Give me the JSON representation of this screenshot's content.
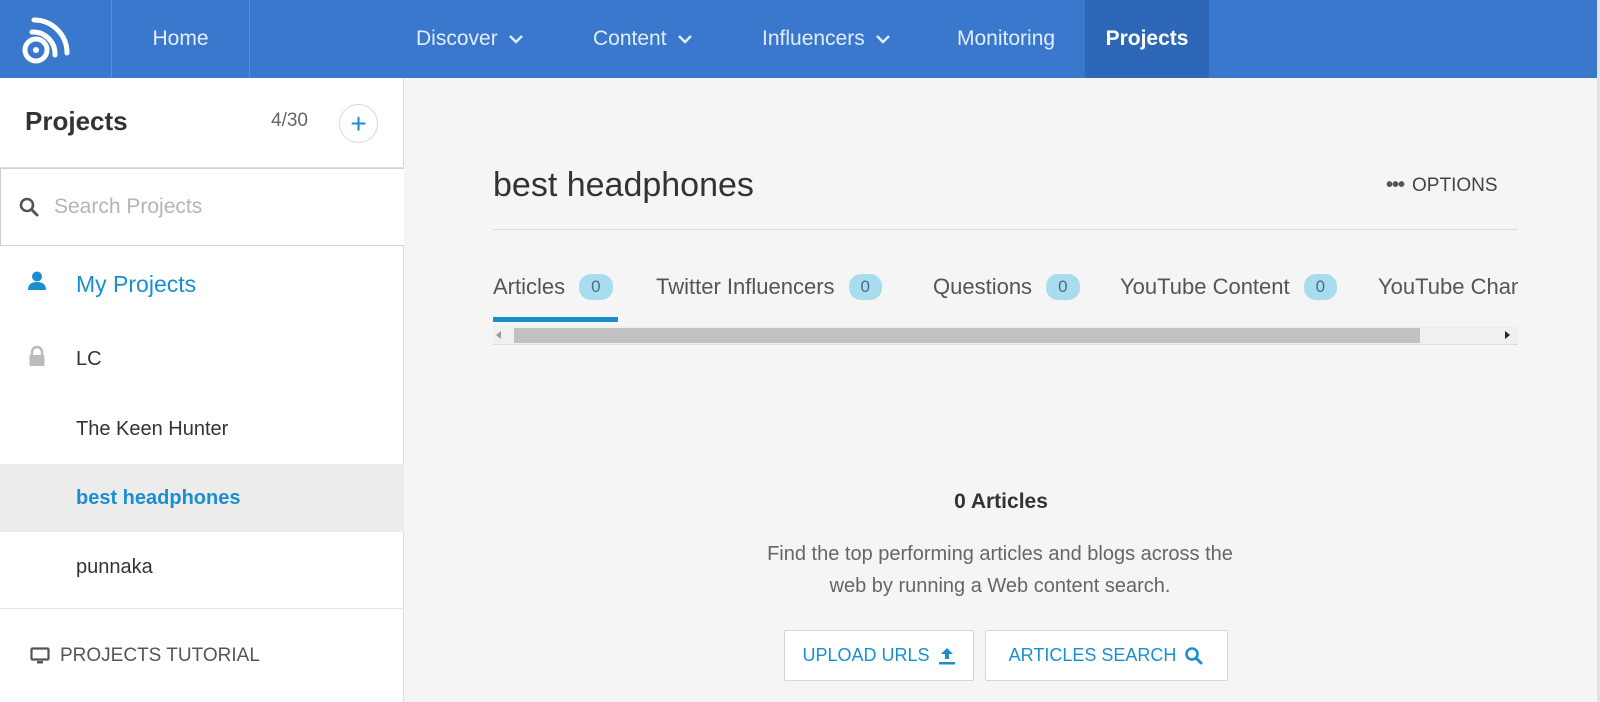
{
  "nav": {
    "home": "Home",
    "items": [
      {
        "label": "Discover",
        "has_dropdown": true
      },
      {
        "label": "Content",
        "has_dropdown": true
      },
      {
        "label": "Influencers",
        "has_dropdown": true
      },
      {
        "label": "Monitoring",
        "has_dropdown": false
      },
      {
        "label": "Projects",
        "has_dropdown": false,
        "active": true
      }
    ]
  },
  "sidebar": {
    "title": "Projects",
    "count": "4/30",
    "add_label": "+",
    "search_placeholder": "Search Projects",
    "items": [
      {
        "label": "My Projects",
        "icon": "user-icon"
      },
      {
        "label": "LC",
        "icon": "lock-icon"
      },
      {
        "label": "The Keen Hunter"
      },
      {
        "label": "best headphones",
        "selected": true
      },
      {
        "label": "punnaka"
      }
    ],
    "tutorial": "PROJECTS TUTORIAL"
  },
  "main": {
    "project_title": "best headphones",
    "options_label": "OPTIONS",
    "tabs": [
      {
        "label": "Articles",
        "count": "0",
        "active": true
      },
      {
        "label": "Twitter Influencers",
        "count": "0"
      },
      {
        "label": "Questions",
        "count": "0"
      },
      {
        "label": "YouTube Content",
        "count": "0"
      },
      {
        "label": "YouTube Chann"
      }
    ],
    "empty": {
      "title": "0 Articles",
      "description": "Find the top performing articles and blogs across the web by running a Web content search."
    },
    "buttons": {
      "upload": "UPLOAD URLS",
      "search": "ARTICLES SEARCH"
    }
  },
  "colors": {
    "nav_bg": "#3a78ce",
    "nav_active": "#2f67b8",
    "accent": "#1a8fd0",
    "badge_bg": "#aadcf0"
  }
}
